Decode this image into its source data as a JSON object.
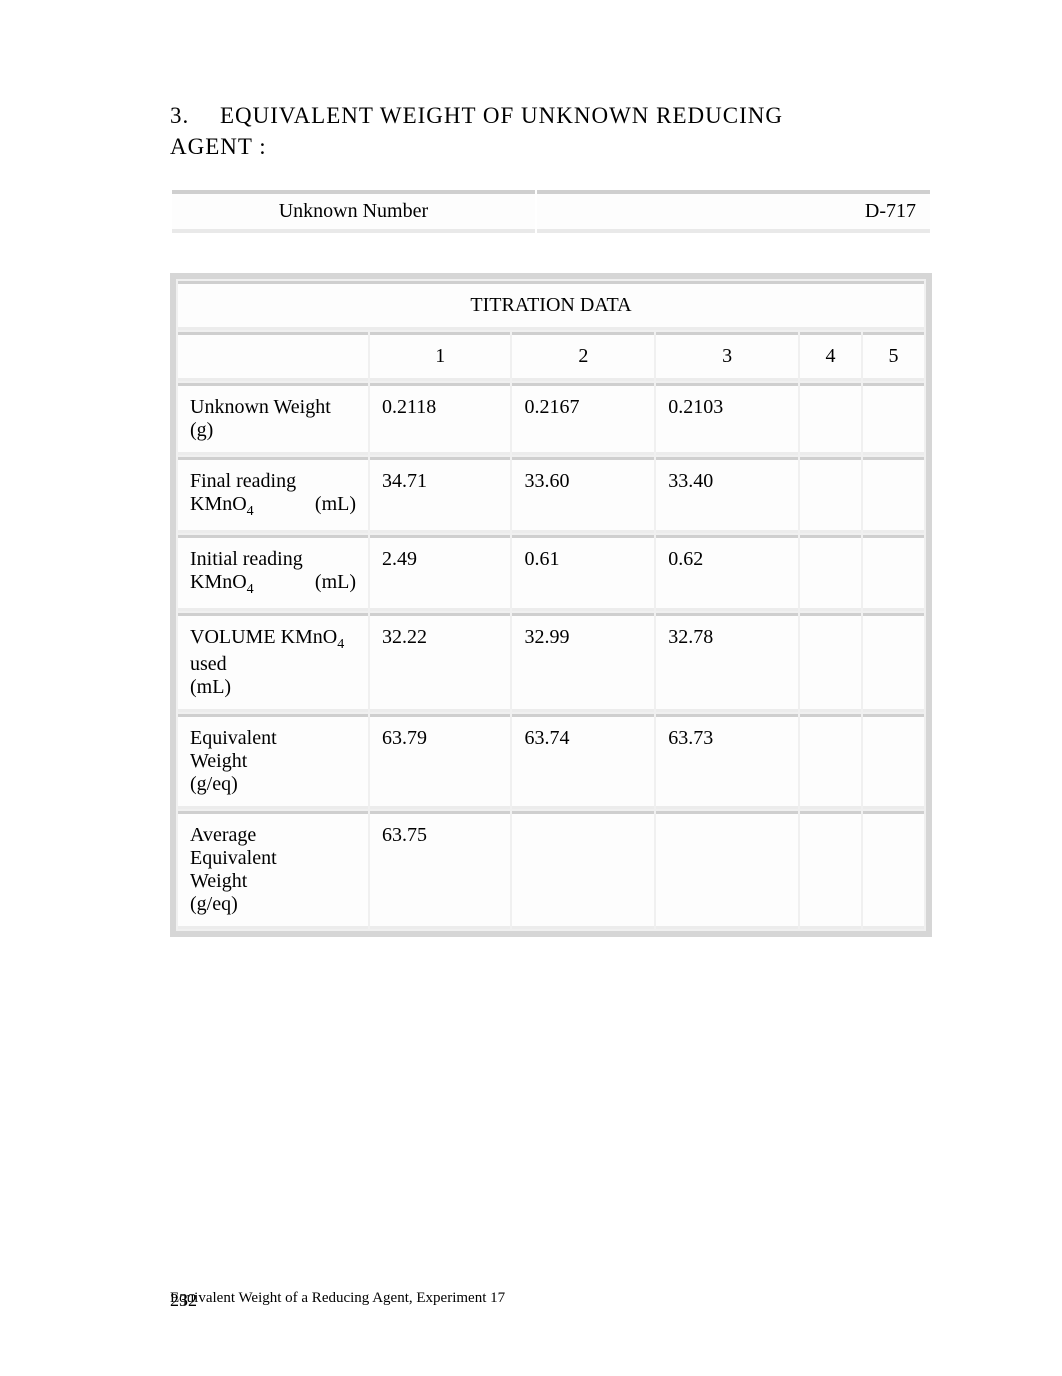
{
  "heading": {
    "number": "3.",
    "title_line1": "EQUIVALENT  WEIGHT  OF  UNKNOWN  REDUCING",
    "title_line2": "AGENT :"
  },
  "unknown": {
    "label": "Unknown Number",
    "value": "D-717"
  },
  "titration": {
    "title": "TITRATION DATA",
    "columns": [
      "1",
      "2",
      "3",
      "4",
      "5"
    ],
    "rows": [
      {
        "label_lines": [
          "Unknown Weight",
          "(g)"
        ],
        "label_layout": "stack",
        "values": [
          "0.2118",
          "0.2167",
          "0.2103",
          "",
          ""
        ]
      },
      {
        "label_lines": [
          "Final reading",
          "KMnO",
          "(mL)"
        ],
        "label_layout": "sub",
        "sub": "4",
        "values": [
          "34.71",
          "33.60",
          "33.40",
          "",
          ""
        ]
      },
      {
        "label_lines": [
          "Initial reading",
          "KMnO",
          "(mL)"
        ],
        "label_layout": "sub",
        "sub": "4",
        "values": [
          "2.49",
          "0.61",
          "0.62",
          "",
          ""
        ]
      },
      {
        "label_lines": [
          "V",
          " KMnO",
          "used",
          "(mL)"
        ],
        "label_layout": "vol",
        "smallcaps": "OLUME",
        "sub": "4",
        "values": [
          "32.22",
          "32.99",
          "32.78",
          "",
          ""
        ]
      },
      {
        "label_lines": [
          "Equivalent",
          "Weight",
          "(g/eq)"
        ],
        "label_layout": "stack",
        "values": [
          "63.79",
          "63.74",
          "63.73",
          "",
          ""
        ]
      },
      {
        "label_lines": [
          "Average",
          "Equivalent",
          "Weight",
          "(g/eq)"
        ],
        "label_layout": "stack",
        "values": [
          "63.75",
          "",
          "",
          "",
          ""
        ]
      }
    ]
  },
  "footer": {
    "text": "Equivalent Weight of a   Reducing Agent, Experiment 17",
    "page_number": "232"
  }
}
